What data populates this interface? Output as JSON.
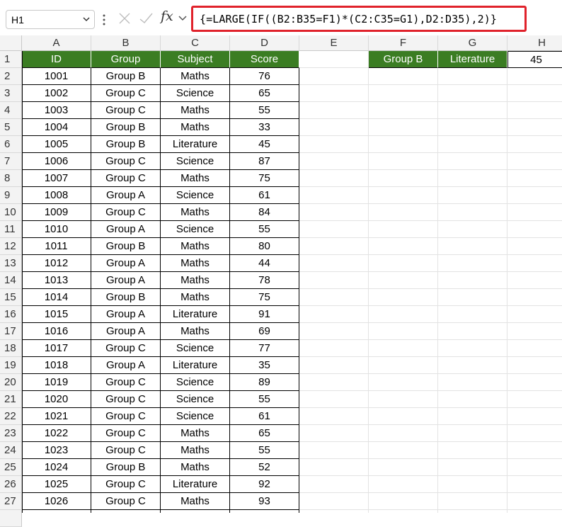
{
  "name_box": "H1",
  "formula_bar": {
    "fx_label": "fx",
    "formula": "{=LARGE(IF((B2:B35=F1)*(C2:C35=G1),D2:D35),2)}"
  },
  "columns": [
    "A",
    "B",
    "C",
    "D",
    "E",
    "F",
    "G",
    "H"
  ],
  "rows": [
    1,
    2,
    3,
    4,
    5,
    6,
    7,
    8,
    9,
    10,
    11,
    12,
    13,
    14,
    15,
    16,
    17,
    18,
    19,
    20,
    21,
    22,
    23,
    24,
    25,
    26,
    27
  ],
  "table": {
    "headers": [
      "ID",
      "Group",
      "Subject",
      "Score"
    ],
    "records": [
      [
        "1001",
        "Group B",
        "Maths",
        "76"
      ],
      [
        "1002",
        "Group C",
        "Science",
        "65"
      ],
      [
        "1003",
        "Group C",
        "Maths",
        "55"
      ],
      [
        "1004",
        "Group B",
        "Maths",
        "33"
      ],
      [
        "1005",
        "Group B",
        "Literature",
        "45"
      ],
      [
        "1006",
        "Group C",
        "Science",
        "87"
      ],
      [
        "1007",
        "Group C",
        "Maths",
        "75"
      ],
      [
        "1008",
        "Group A",
        "Science",
        "61"
      ],
      [
        "1009",
        "Group C",
        "Maths",
        "84"
      ],
      [
        "1010",
        "Group A",
        "Science",
        "55"
      ],
      [
        "1011",
        "Group B",
        "Maths",
        "80"
      ],
      [
        "1012",
        "Group A",
        "Maths",
        "44"
      ],
      [
        "1013",
        "Group A",
        "Maths",
        "78"
      ],
      [
        "1014",
        "Group B",
        "Maths",
        "75"
      ],
      [
        "1015",
        "Group A",
        "Literature",
        "91"
      ],
      [
        "1016",
        "Group A",
        "Maths",
        "69"
      ],
      [
        "1017",
        "Group C",
        "Science",
        "77"
      ],
      [
        "1018",
        "Group A",
        "Literature",
        "35"
      ],
      [
        "1019",
        "Group C",
        "Science",
        "89"
      ],
      [
        "1020",
        "Group C",
        "Science",
        "55"
      ],
      [
        "1021",
        "Group C",
        "Science",
        "61"
      ],
      [
        "1022",
        "Group C",
        "Maths",
        "65"
      ],
      [
        "1023",
        "Group C",
        "Maths",
        "55"
      ],
      [
        "1024",
        "Group B",
        "Maths",
        "52"
      ],
      [
        "1025",
        "Group C",
        "Literature",
        "92"
      ],
      [
        "1026",
        "Group C",
        "Maths",
        "93"
      ]
    ]
  },
  "criteria": {
    "F1": "Group B",
    "G1": "Literature",
    "H1": "45"
  },
  "colors": {
    "header_fill": "#3b7d23",
    "formula_highlight": "#e0222b"
  }
}
